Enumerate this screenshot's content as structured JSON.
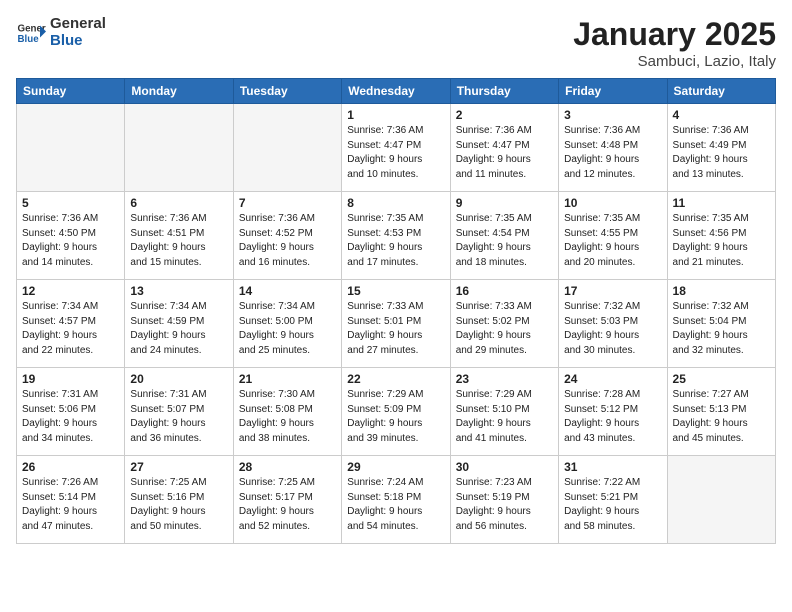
{
  "header": {
    "logo_general": "General",
    "logo_blue": "Blue",
    "month": "January 2025",
    "location": "Sambuci, Lazio, Italy"
  },
  "weekdays": [
    "Sunday",
    "Monday",
    "Tuesday",
    "Wednesday",
    "Thursday",
    "Friday",
    "Saturday"
  ],
  "weeks": [
    [
      {
        "day": "",
        "info": ""
      },
      {
        "day": "",
        "info": ""
      },
      {
        "day": "",
        "info": ""
      },
      {
        "day": "1",
        "info": "Sunrise: 7:36 AM\nSunset: 4:47 PM\nDaylight: 9 hours\nand 10 minutes."
      },
      {
        "day": "2",
        "info": "Sunrise: 7:36 AM\nSunset: 4:47 PM\nDaylight: 9 hours\nand 11 minutes."
      },
      {
        "day": "3",
        "info": "Sunrise: 7:36 AM\nSunset: 4:48 PM\nDaylight: 9 hours\nand 12 minutes."
      },
      {
        "day": "4",
        "info": "Sunrise: 7:36 AM\nSunset: 4:49 PM\nDaylight: 9 hours\nand 13 minutes."
      }
    ],
    [
      {
        "day": "5",
        "info": "Sunrise: 7:36 AM\nSunset: 4:50 PM\nDaylight: 9 hours\nand 14 minutes."
      },
      {
        "day": "6",
        "info": "Sunrise: 7:36 AM\nSunset: 4:51 PM\nDaylight: 9 hours\nand 15 minutes."
      },
      {
        "day": "7",
        "info": "Sunrise: 7:36 AM\nSunset: 4:52 PM\nDaylight: 9 hours\nand 16 minutes."
      },
      {
        "day": "8",
        "info": "Sunrise: 7:35 AM\nSunset: 4:53 PM\nDaylight: 9 hours\nand 17 minutes."
      },
      {
        "day": "9",
        "info": "Sunrise: 7:35 AM\nSunset: 4:54 PM\nDaylight: 9 hours\nand 18 minutes."
      },
      {
        "day": "10",
        "info": "Sunrise: 7:35 AM\nSunset: 4:55 PM\nDaylight: 9 hours\nand 20 minutes."
      },
      {
        "day": "11",
        "info": "Sunrise: 7:35 AM\nSunset: 4:56 PM\nDaylight: 9 hours\nand 21 minutes."
      }
    ],
    [
      {
        "day": "12",
        "info": "Sunrise: 7:34 AM\nSunset: 4:57 PM\nDaylight: 9 hours\nand 22 minutes."
      },
      {
        "day": "13",
        "info": "Sunrise: 7:34 AM\nSunset: 4:59 PM\nDaylight: 9 hours\nand 24 minutes."
      },
      {
        "day": "14",
        "info": "Sunrise: 7:34 AM\nSunset: 5:00 PM\nDaylight: 9 hours\nand 25 minutes."
      },
      {
        "day": "15",
        "info": "Sunrise: 7:33 AM\nSunset: 5:01 PM\nDaylight: 9 hours\nand 27 minutes."
      },
      {
        "day": "16",
        "info": "Sunrise: 7:33 AM\nSunset: 5:02 PM\nDaylight: 9 hours\nand 29 minutes."
      },
      {
        "day": "17",
        "info": "Sunrise: 7:32 AM\nSunset: 5:03 PM\nDaylight: 9 hours\nand 30 minutes."
      },
      {
        "day": "18",
        "info": "Sunrise: 7:32 AM\nSunset: 5:04 PM\nDaylight: 9 hours\nand 32 minutes."
      }
    ],
    [
      {
        "day": "19",
        "info": "Sunrise: 7:31 AM\nSunset: 5:06 PM\nDaylight: 9 hours\nand 34 minutes."
      },
      {
        "day": "20",
        "info": "Sunrise: 7:31 AM\nSunset: 5:07 PM\nDaylight: 9 hours\nand 36 minutes."
      },
      {
        "day": "21",
        "info": "Sunrise: 7:30 AM\nSunset: 5:08 PM\nDaylight: 9 hours\nand 38 minutes."
      },
      {
        "day": "22",
        "info": "Sunrise: 7:29 AM\nSunset: 5:09 PM\nDaylight: 9 hours\nand 39 minutes."
      },
      {
        "day": "23",
        "info": "Sunrise: 7:29 AM\nSunset: 5:10 PM\nDaylight: 9 hours\nand 41 minutes."
      },
      {
        "day": "24",
        "info": "Sunrise: 7:28 AM\nSunset: 5:12 PM\nDaylight: 9 hours\nand 43 minutes."
      },
      {
        "day": "25",
        "info": "Sunrise: 7:27 AM\nSunset: 5:13 PM\nDaylight: 9 hours\nand 45 minutes."
      }
    ],
    [
      {
        "day": "26",
        "info": "Sunrise: 7:26 AM\nSunset: 5:14 PM\nDaylight: 9 hours\nand 47 minutes."
      },
      {
        "day": "27",
        "info": "Sunrise: 7:25 AM\nSunset: 5:16 PM\nDaylight: 9 hours\nand 50 minutes."
      },
      {
        "day": "28",
        "info": "Sunrise: 7:25 AM\nSunset: 5:17 PM\nDaylight: 9 hours\nand 52 minutes."
      },
      {
        "day": "29",
        "info": "Sunrise: 7:24 AM\nSunset: 5:18 PM\nDaylight: 9 hours\nand 54 minutes."
      },
      {
        "day": "30",
        "info": "Sunrise: 7:23 AM\nSunset: 5:19 PM\nDaylight: 9 hours\nand 56 minutes."
      },
      {
        "day": "31",
        "info": "Sunrise: 7:22 AM\nSunset: 5:21 PM\nDaylight: 9 hours\nand 58 minutes."
      },
      {
        "day": "",
        "info": ""
      }
    ]
  ]
}
